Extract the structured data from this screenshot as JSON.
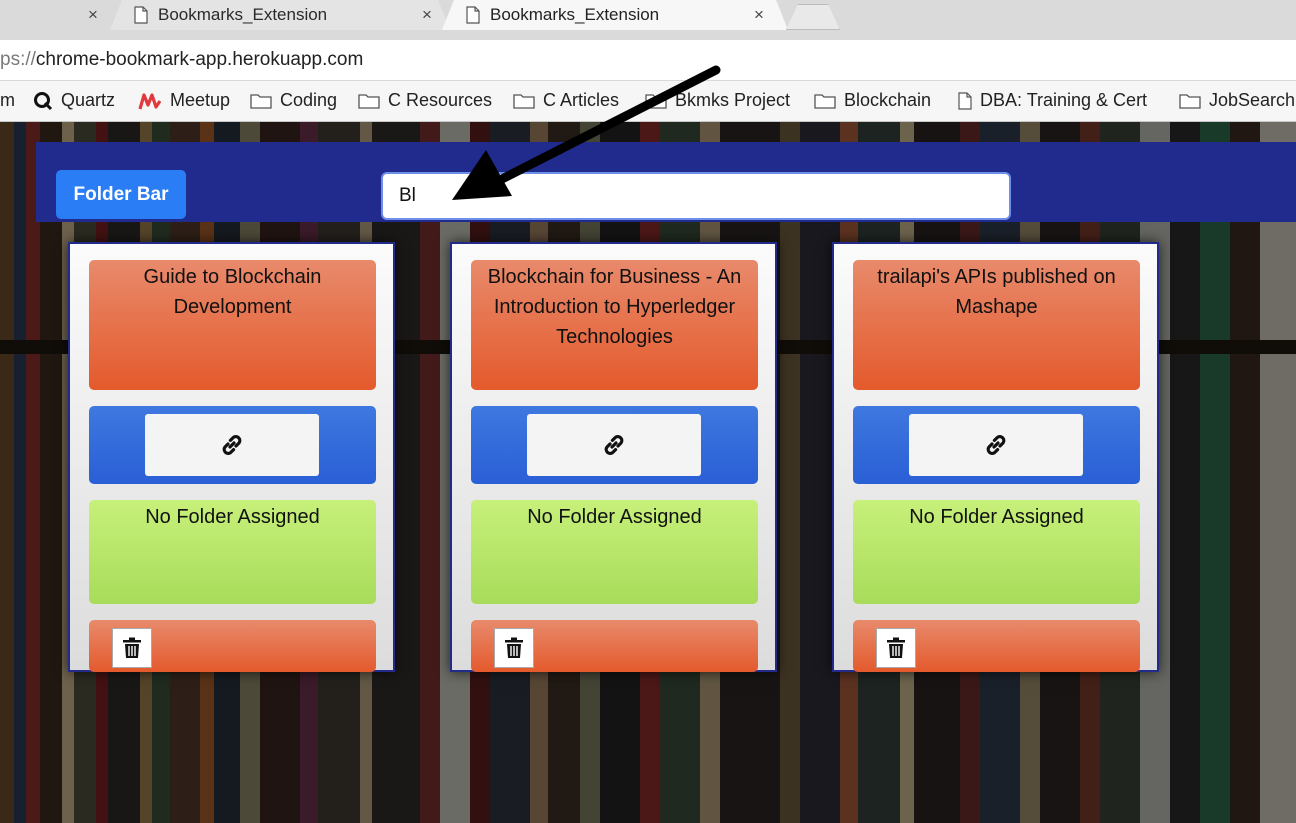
{
  "browser": {
    "tabs": [
      {
        "label": "Bookmarks_Extension",
        "close": "×",
        "active": false
      },
      {
        "label": "Bookmarks_Extension",
        "close": "×",
        "active": true
      }
    ],
    "first_tab_close": "×",
    "address": {
      "scheme": "ps://",
      "host": "chrome-bookmark-app.herokuapp.com"
    },
    "bookmarks": [
      {
        "label": "m",
        "icon": "partial-icon"
      },
      {
        "label": "Quartz",
        "icon": "quartz-icon"
      },
      {
        "label": "Meetup",
        "icon": "meetup-icon"
      },
      {
        "label": "Coding",
        "icon": "folder-icon"
      },
      {
        "label": "C Resources",
        "icon": "folder-icon"
      },
      {
        "label": "C Articles",
        "icon": "folder-icon"
      },
      {
        "label": "Bkmks Project",
        "icon": "folder-icon"
      },
      {
        "label": "Blockchain",
        "icon": "folder-icon"
      },
      {
        "label": "DBA: Training & Cert",
        "icon": "page-icon"
      },
      {
        "label": "JobSearch",
        "icon": "folder-icon"
      }
    ]
  },
  "app": {
    "folder_bar_label": "Folder Bar",
    "search_value": "Bl",
    "cards": [
      {
        "title": "Guide to Blockchain Development",
        "folder": "No Folder Assigned"
      },
      {
        "title": "Blockchain for Business - An Introduction to Hyperledger Technologies",
        "folder": "No Folder Assigned"
      },
      {
        "title": "trailapi's APIs published on Mashape",
        "folder": "No Folder Assigned"
      }
    ]
  },
  "colors": {
    "navbar": "#212b8e",
    "folder_button": "#2b7df5",
    "title_box": "#e45a2c",
    "link_box": "#2a5fd6",
    "folder_box": "#a8dc5a"
  }
}
